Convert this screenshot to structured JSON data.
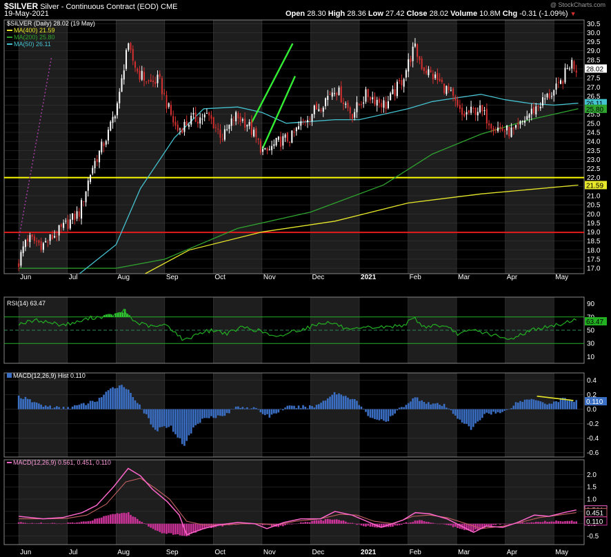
{
  "header": {
    "ticker": "$SILVER",
    "description": "Silver - Continuous Contract (EOD)",
    "exchange": "CME",
    "date": "19-May-2021",
    "open_label": "Open",
    "open": "28.30",
    "high_label": "High",
    "high": "28.36",
    "low_label": "Low",
    "low": "27.42",
    "close_label": "Close",
    "close": "28.02",
    "volume_label": "Volume",
    "volume": "10.8M",
    "chg_label": "Chg",
    "chg": "-0.31 (-1.09%)",
    "watermark": "@ StockCharts.com"
  },
  "colors": {
    "background": "#000000",
    "panel_stripe": "#1e1e1e",
    "grid": "#3c3c3c",
    "candle_up": "#ffffff",
    "candle_down": "#d63030",
    "ma400": "#e8e82a",
    "ma200": "#2fa52f",
    "ma50": "#45c2d0",
    "support_yellow": "#ffff00",
    "support_red": "#e31b1b",
    "channel": "#33ee33",
    "trend_dotted": "#b03fb0",
    "rsi_line": "#22b022",
    "rsi_fill": "#33cc33",
    "macd_hist": "#3a6fc4",
    "macd_line": "#ff66cc",
    "macd_signal": "#c06060",
    "macd_hist2": "#cc3399",
    "divergence": "#e8e82a"
  },
  "chart_data": [
    {
      "type": "candlestick",
      "title": "$SILVER (Daily) 28.02 (19 May)",
      "legend": [
        {
          "name": "MA(400) 21.59",
          "color": "#e8e82a"
        },
        {
          "name": "MA(200) 25.80",
          "color": "#2fa52f"
        },
        {
          "name": "MA(50) 26.11",
          "color": "#45c2d0"
        }
      ],
      "ylim": [
        16.7,
        30.7
      ],
      "y_ticks": [
        "17.0",
        "17.5",
        "18.0",
        "18.5",
        "19.0",
        "19.5",
        "20.0",
        "20.5",
        "21.0",
        "21.5",
        "22.0",
        "22.5",
        "23.0",
        "23.5",
        "24.0",
        "24.5",
        "25.0",
        "25.5",
        "26.0",
        "26.5",
        "27.0",
        "27.5",
        "28.0",
        "28.5",
        "29.0",
        "29.5",
        "30.0",
        "30.5"
      ],
      "price_flags": [
        {
          "value": 28.02,
          "label": "28.02",
          "color": "#ffffff",
          "text_color": "#000000"
        },
        {
          "value": 26.11,
          "label": "26.11",
          "color": "#45c2d0",
          "text_color": "#000000"
        },
        {
          "value": 25.8,
          "label": "25.80",
          "color": "#2fa52f",
          "text_color": "#000000"
        },
        {
          "value": 21.59,
          "label": "21.59",
          "color": "#e8e82a",
          "text_color": "#000000"
        }
      ],
      "horizontal_lines": [
        {
          "value": 22.0,
          "color": "#ffff00"
        },
        {
          "value": 18.98,
          "color": "#e31b1b"
        }
      ],
      "trendlines": [
        {
          "from": [
            0.0,
            18.6
          ],
          "to": [
            0.67,
            28.6
          ],
          "color": "#b03fb0",
          "style": "dotted"
        },
        {
          "from": [
            4.78,
            25.0
          ],
          "to": [
            5.63,
            29.4
          ],
          "color": "#33ee33"
        },
        {
          "from": [
            5.01,
            23.6
          ],
          "to": [
            5.68,
            27.6
          ],
          "color": "#33ee33"
        }
      ],
      "price_path": [
        [
          0.0,
          17.3
        ],
        [
          0.15,
          18.7
        ],
        [
          0.5,
          18.3
        ],
        [
          0.9,
          19.2
        ],
        [
          1.25,
          20.1
        ],
        [
          1.5,
          22.5
        ],
        [
          1.85,
          24.5
        ],
        [
          2.08,
          26.6
        ],
        [
          2.22,
          29.3
        ],
        [
          2.45,
          27.8
        ],
        [
          2.7,
          27.2
        ],
        [
          2.88,
          27.4
        ],
        [
          3.05,
          26.0
        ],
        [
          3.25,
          24.6
        ],
        [
          3.55,
          25.2
        ],
        [
          3.9,
          25.4
        ],
        [
          4.2,
          24.2
        ],
        [
          4.45,
          25.4
        ],
        [
          4.7,
          25.0
        ],
        [
          5.05,
          23.3
        ],
        [
          5.35,
          24.0
        ],
        [
          5.6,
          24.2
        ],
        [
          5.9,
          25.3
        ],
        [
          6.2,
          26.0
        ],
        [
          6.5,
          27.0
        ],
        [
          6.85,
          25.5
        ],
        [
          7.15,
          26.6
        ],
        [
          7.55,
          26.0
        ],
        [
          7.88,
          27.4
        ],
        [
          8.13,
          29.2
        ],
        [
          8.3,
          28.1
        ],
        [
          8.6,
          27.4
        ],
        [
          8.85,
          26.7
        ],
        [
          9.1,
          25.4
        ],
        [
          9.45,
          25.8
        ],
        [
          9.78,
          24.8
        ],
        [
          10.0,
          24.6
        ],
        [
          10.2,
          24.5
        ],
        [
          10.45,
          25.4
        ],
        [
          10.8,
          26.3
        ],
        [
          11.1,
          27.0
        ],
        [
          11.35,
          28.4
        ],
        [
          11.46,
          28.02
        ]
      ],
      "ma_series": [
        {
          "name": "MA(400)",
          "points": [
            [
              2.6,
              16.7
            ],
            [
              3.5,
              18.0
            ],
            [
              5.0,
              19.0
            ],
            [
              6.5,
              19.6
            ],
            [
              8.0,
              20.6
            ],
            [
              9.5,
              21.1
            ],
            [
              11.5,
              21.59
            ]
          ]
        },
        {
          "name": "MA(200)",
          "points": [
            [
              0.0,
              17.0
            ],
            [
              2.0,
              17.0
            ],
            [
              3.0,
              17.5
            ],
            [
              4.5,
              19.2
            ],
            [
              6.0,
              20.1
            ],
            [
              7.5,
              21.6
            ],
            [
              8.5,
              23.3
            ],
            [
              9.5,
              24.4
            ],
            [
              10.5,
              25.2
            ],
            [
              11.5,
              25.8
            ]
          ]
        },
        {
          "name": "MA(50)",
          "points": [
            [
              1.25,
              16.7
            ],
            [
              2.0,
              18.3
            ],
            [
              2.5,
              21.4
            ],
            [
              3.2,
              24.2
            ],
            [
              3.8,
              25.8
            ],
            [
              4.5,
              25.9
            ],
            [
              5.0,
              25.6
            ],
            [
              5.5,
              25.0
            ],
            [
              6.0,
              25.1
            ],
            [
              6.5,
              25.2
            ],
            [
              7.0,
              25.2
            ],
            [
              7.5,
              25.5
            ],
            [
              8.0,
              25.8
            ],
            [
              8.5,
              26.2
            ],
            [
              9.0,
              26.4
            ],
            [
              9.5,
              26.6
            ],
            [
              10.0,
              26.3
            ],
            [
              10.5,
              26.1
            ],
            [
              11.0,
              26.0
            ],
            [
              11.5,
              26.11
            ]
          ]
        }
      ]
    },
    {
      "type": "line",
      "title": "RSI(14) 63.47",
      "ylim": [
        0,
        100
      ],
      "y_ticks": [
        "10",
        "30",
        "50",
        "70",
        "90"
      ],
      "levels": [
        70,
        50,
        30
      ],
      "current_value": "63.47",
      "points": [
        [
          0.0,
          60
        ],
        [
          0.4,
          65
        ],
        [
          0.9,
          58
        ],
        [
          1.2,
          62
        ],
        [
          1.5,
          69
        ],
        [
          1.8,
          71
        ],
        [
          2.05,
          74
        ],
        [
          2.15,
          80
        ],
        [
          2.4,
          62
        ],
        [
          2.75,
          55
        ],
        [
          3.05,
          58
        ],
        [
          3.2,
          48
        ],
        [
          3.4,
          34
        ],
        [
          3.7,
          46
        ],
        [
          4.0,
          50
        ],
        [
          4.3,
          45
        ],
        [
          4.6,
          55
        ],
        [
          5.0,
          48
        ],
        [
          5.3,
          38
        ],
        [
          5.6,
          48
        ],
        [
          5.9,
          53
        ],
        [
          6.25,
          62
        ],
        [
          6.5,
          60
        ],
        [
          6.8,
          49
        ],
        [
          7.2,
          54
        ],
        [
          7.6,
          55
        ],
        [
          7.9,
          58
        ],
        [
          8.15,
          68
        ],
        [
          8.3,
          55
        ],
        [
          8.6,
          58
        ],
        [
          8.85,
          52
        ],
        [
          9.05,
          44
        ],
        [
          9.35,
          50
        ],
        [
          9.7,
          44
        ],
        [
          10.05,
          35
        ],
        [
          10.3,
          43
        ],
        [
          10.6,
          52
        ],
        [
          10.9,
          55
        ],
        [
          11.2,
          60
        ],
        [
          11.4,
          67
        ],
        [
          11.46,
          63.47
        ]
      ]
    },
    {
      "type": "bar",
      "title": "MACD(12,26,9) Hist 0.110",
      "ylim": [
        -0.66,
        0.5
      ],
      "y_ticks": [
        "-0.6",
        "-0.4",
        "-0.2",
        "0.0",
        "0.2",
        "0.4"
      ],
      "current_value": "0.110",
      "divergence_line": {
        "from": [
          10.65,
          0.18
        ],
        "to": [
          11.4,
          0.12
        ]
      },
      "points": [
        [
          0.0,
          0.18
        ],
        [
          0.5,
          0.05
        ],
        [
          0.9,
          0.01
        ],
        [
          1.3,
          0.06
        ],
        [
          1.6,
          0.12
        ],
        [
          1.95,
          0.3
        ],
        [
          2.15,
          0.34
        ],
        [
          2.5,
          0.05
        ],
        [
          2.8,
          -0.3
        ],
        [
          3.1,
          -0.22
        ],
        [
          3.4,
          -0.5
        ],
        [
          3.6,
          -0.25
        ],
        [
          3.85,
          -0.1
        ],
        [
          4.2,
          -0.1
        ],
        [
          4.5,
          0.04
        ],
        [
          4.8,
          0.02
        ],
        [
          5.15,
          -0.1
        ],
        [
          5.5,
          0.03
        ],
        [
          5.8,
          0.03
        ],
        [
          6.1,
          0.04
        ],
        [
          6.5,
          0.23
        ],
        [
          6.9,
          0.14
        ],
        [
          7.2,
          -0.1
        ],
        [
          7.55,
          -0.18
        ],
        [
          7.85,
          0.02
        ],
        [
          8.15,
          0.16
        ],
        [
          8.45,
          0.08
        ],
        [
          8.75,
          0.05
        ],
        [
          9.0,
          -0.1
        ],
        [
          9.3,
          -0.28
        ],
        [
          9.6,
          -0.05
        ],
        [
          9.95,
          -0.05
        ],
        [
          10.25,
          0.1
        ],
        [
          10.6,
          0.15
        ],
        [
          10.9,
          0.07
        ],
        [
          11.2,
          0.15
        ],
        [
          11.46,
          0.11
        ]
      ]
    },
    {
      "type": "line",
      "title": "MACD(12,26,9) 0.561, 0.451, 0.110",
      "ylim": [
        -0.85,
        2.6
      ],
      "y_ticks": [
        "-0.5",
        "0.0",
        "0.5",
        "1.0",
        "1.5",
        "2.0"
      ],
      "current_values": [
        "0.561",
        "0.451",
        "0.110"
      ],
      "series": [
        {
          "name": "MACD",
          "points": [
            [
              0.0,
              0.3
            ],
            [
              0.5,
              0.2
            ],
            [
              0.9,
              0.25
            ],
            [
              1.3,
              0.45
            ],
            [
              1.6,
              0.75
            ],
            [
              1.95,
              1.5
            ],
            [
              2.25,
              2.25
            ],
            [
              2.5,
              1.95
            ],
            [
              2.75,
              1.4
            ],
            [
              3.05,
              0.9
            ],
            [
              3.3,
              0.35
            ],
            [
              3.45,
              -0.45
            ],
            [
              3.8,
              -0.2
            ],
            [
              4.1,
              -0.05
            ],
            [
              4.5,
              0.05
            ],
            [
              4.85,
              0.0
            ],
            [
              5.1,
              -0.2
            ],
            [
              5.45,
              0.05
            ],
            [
              5.8,
              0.2
            ],
            [
              6.2,
              0.2
            ],
            [
              6.5,
              0.5
            ],
            [
              6.85,
              0.35
            ],
            [
              7.15,
              0.1
            ],
            [
              7.45,
              -0.15
            ],
            [
              7.9,
              0.15
            ],
            [
              8.15,
              0.45
            ],
            [
              8.45,
              0.4
            ],
            [
              8.8,
              0.2
            ],
            [
              9.05,
              -0.05
            ],
            [
              9.35,
              -0.35
            ],
            [
              9.6,
              -0.1
            ],
            [
              9.95,
              -0.15
            ],
            [
              10.25,
              0.05
            ],
            [
              10.6,
              0.35
            ],
            [
              10.9,
              0.3
            ],
            [
              11.2,
              0.45
            ],
            [
              11.46,
              0.561
            ]
          ]
        },
        {
          "name": "Signal",
          "points": [
            [
              0.0,
              0.2
            ],
            [
              0.6,
              0.2
            ],
            [
              1.0,
              0.22
            ],
            [
              1.4,
              0.35
            ],
            [
              1.8,
              0.8
            ],
            [
              2.2,
              1.7
            ],
            [
              2.5,
              1.85
            ],
            [
              2.8,
              1.45
            ],
            [
              3.1,
              1.0
            ],
            [
              3.45,
              0.1
            ],
            [
              3.8,
              -0.05
            ],
            [
              4.2,
              -0.05
            ],
            [
              4.6,
              0.0
            ],
            [
              5.0,
              0.0
            ],
            [
              5.3,
              -0.05
            ],
            [
              5.7,
              0.1
            ],
            [
              6.2,
              0.2
            ],
            [
              6.6,
              0.38
            ],
            [
              6.95,
              0.35
            ],
            [
              7.3,
              0.1
            ],
            [
              7.7,
              0.0
            ],
            [
              8.1,
              0.3
            ],
            [
              8.45,
              0.35
            ],
            [
              8.8,
              0.25
            ],
            [
              9.2,
              0.0
            ],
            [
              9.5,
              -0.2
            ],
            [
              9.95,
              -0.1
            ],
            [
              10.3,
              0.05
            ],
            [
              10.7,
              0.25
            ],
            [
              11.1,
              0.35
            ],
            [
              11.46,
              0.451
            ]
          ]
        }
      ],
      "histogram": [
        [
          0.0,
          0.05
        ],
        [
          0.8,
          0.0
        ],
        [
          1.4,
          0.08
        ],
        [
          1.9,
          0.4
        ],
        [
          2.25,
          0.45
        ],
        [
          2.5,
          0.1
        ],
        [
          2.9,
          -0.35
        ],
        [
          3.45,
          -0.5
        ],
        [
          3.8,
          -0.2
        ],
        [
          4.3,
          -0.05
        ],
        [
          4.9,
          0.0
        ],
        [
          5.3,
          -0.12
        ],
        [
          5.8,
          0.05
        ],
        [
          6.5,
          0.2
        ],
        [
          7.1,
          -0.1
        ],
        [
          7.6,
          -0.15
        ],
        [
          8.2,
          0.15
        ],
        [
          8.8,
          -0.05
        ],
        [
          9.3,
          -0.3
        ],
        [
          9.8,
          -0.05
        ],
        [
          10.4,
          0.05
        ],
        [
          10.9,
          0.1
        ],
        [
          11.46,
          0.11
        ]
      ]
    }
  ],
  "x_axis": {
    "months": [
      "Jun",
      "Jul",
      "Aug",
      "Sep",
      "Oct",
      "Nov",
      "Dec",
      "2021",
      "Feb",
      "Mar",
      "Apr",
      "May"
    ],
    "month_positions": [
      0,
      1,
      2,
      3,
      4,
      5,
      6,
      7,
      8,
      9,
      10,
      11
    ],
    "x_range": [
      -0.3,
      11.62
    ],
    "bold_label": "2021"
  }
}
